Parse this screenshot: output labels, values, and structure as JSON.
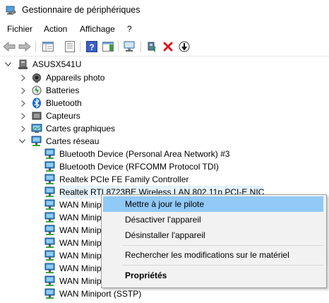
{
  "window": {
    "title": "Gestionnaire de périphériques"
  },
  "menu": [
    {
      "label": "Fichier"
    },
    {
      "label": "Action"
    },
    {
      "label": "Affichage"
    },
    {
      "label": "?"
    }
  ],
  "toolbar": {
    "icons": [
      "back-arrow-icon",
      "forward-arrow-icon",
      "show-hide-console-tree-icon",
      "properties-icon",
      "help-icon",
      "show-action-pane-icon",
      "scan-hardware-changes-icon",
      "update-driver-icon",
      "uninstall-device-icon",
      "disable-device-icon"
    ]
  },
  "tree": {
    "root": "ASUSX541U",
    "categories": [
      {
        "label": "Appareils photo",
        "icon": "camera-icon"
      },
      {
        "label": "Batteries",
        "icon": "battery-icon"
      },
      {
        "label": "Bluetooth",
        "icon": "bluetooth-icon"
      },
      {
        "label": "Capteurs",
        "icon": "sensor-icon"
      },
      {
        "label": "Cartes graphiques",
        "icon": "display-adapter-icon"
      },
      {
        "label": "Cartes réseau",
        "icon": "network-adapter-icon"
      }
    ],
    "network_devices": [
      "Bluetooth Device (Personal Area Network) #3",
      "Bluetooth Device (RFCOMM Protocol TDI)",
      "Realtek PCIe FE Family Controller",
      "Realtek RTL8723BE Wireless LAN 802.11n PCI-E NIC",
      "WAN Minip",
      "WAN Minip",
      "WAN Minip",
      "WAN Minip",
      "WAN Minip",
      "WAN Minip",
      "WAN Minip",
      "WAN Miniport (SSTP)"
    ]
  },
  "context_menu": {
    "items": [
      {
        "label": "Mettre à jour le pilote",
        "highlighted": true
      },
      {
        "label": "Désactiver l'appareil"
      },
      {
        "label": "Désinstaller l'appareil"
      },
      {
        "label": "Rechercher les modifications sur le matériel"
      },
      {
        "label": "Propriétés",
        "bold": true
      }
    ]
  },
  "colors": {
    "selection": "#e5f3ff",
    "menu_highlight": "#91c9f7",
    "menu_background": "#f2f2f2"
  }
}
